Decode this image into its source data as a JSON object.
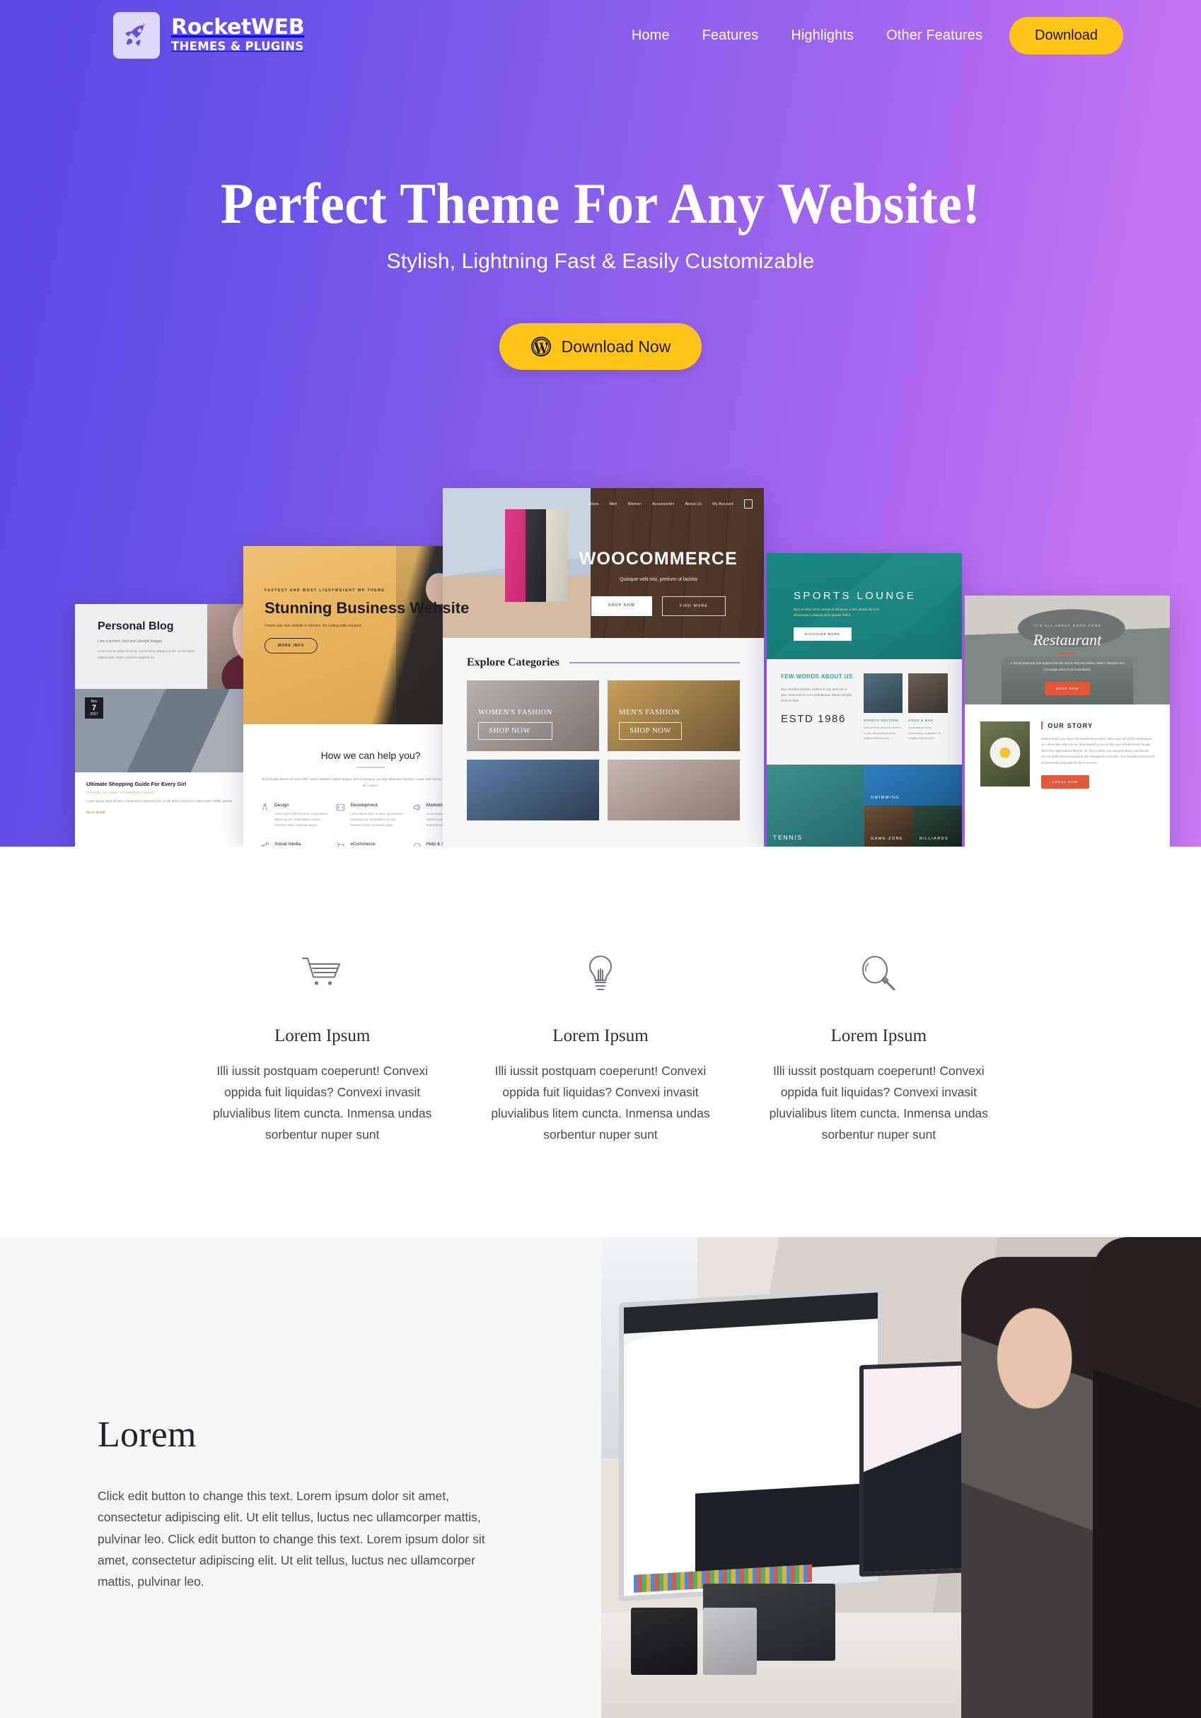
{
  "brand": {
    "name": "RocketWEB",
    "tagline": "THEMES & PLUGINS",
    "icon": "rocket-icon"
  },
  "nav": {
    "links": [
      {
        "label": "Home"
      },
      {
        "label": "Features"
      },
      {
        "label": "Highlights"
      },
      {
        "label": "Other Features"
      }
    ],
    "cta_label": "Download"
  },
  "hero": {
    "title": "Perfect Theme For Any Website!",
    "subtitle": "Stylish, Lightning Fast & Easily Customizable",
    "cta_label": "Download Now",
    "cta_icon": "wordpress-icon",
    "gradient_start": "#5748e2",
    "gradient_end": "#c778f3",
    "accent_yellow": "#ffc414"
  },
  "showcase": {
    "blog": {
      "title": "Personal Blog",
      "tagline": "I am a fashion, food and Lifestyle blogger",
      "intro": "Lorem ipsum dolor sit amet, consectetur adipiscing elit. Ut elit tellus, ullamcorper mattis, pulvinar dapibus leo.",
      "date_month": "Nov",
      "date_day": "7",
      "date_year": "2017",
      "post_title": "Ultimate Shopping Guide For Every Girl",
      "post_meta": "FASHION / 121 LIKES / 4 COMMENTS / SHARE",
      "post_excerpt": "Lorem ipsum dolor sit amet, consectetur adipiscing elit. Ut elit tellus, luctus nec ullamcorper mattis, pulvina",
      "read_more": "READ MORE"
    },
    "business": {
      "kicker": "FASTEST AND MOST LIGHTWEIGHT WP THEME",
      "title": "Stunning Business Website",
      "tagline": "Create your own website in minutes. No coding skills required.",
      "button": "MORE INFO",
      "section_title": "How we can help you?",
      "section_text": "Sed Fringilla Mauris Sit Amet Nibh. Donec Sodales Sagittis Magna. Sed Consequat, Leo Eget Bibendum Sodales, Augue Velit Cursus Nunc, Quis Gravida Magna Mi A Libero.",
      "services": [
        {
          "name": "Design",
          "icon": "compass-icon",
          "text": "Lorem ipsum dolor sit amet, consectetuer adipiscing elit. Suspendisse et justo. Praesent mattis commodo augue."
        },
        {
          "name": "Development",
          "icon": "code-icon",
          "text": "Lorem ipsum dolor sit amet, consectetuer adipiscing elit. Suspendisse et justo. Praesent mattis commodo augue."
        },
        {
          "name": "Marketing",
          "icon": "megaphone-icon",
          "text": "Lorem ipsum dolor sit amet, consectetuer adipiscing elit. Suspendisse et justo. Praesent mattis commodo augue."
        },
        {
          "name": "Social media",
          "icon": "share-icon",
          "text": ""
        },
        {
          "name": "eCommerce",
          "icon": "cart-icon",
          "text": ""
        },
        {
          "name": "Help & Support",
          "icon": "support-icon",
          "text": ""
        }
      ]
    },
    "woocommerce": {
      "nav": [
        "Store",
        "Men",
        "Women",
        "Accessories",
        "About Us",
        "My Account"
      ],
      "cart_icon": "bag-icon",
      "title": "WOOCOMMERCE",
      "tagline": "Quisque velit nisi, pretium ut lacinia",
      "btn_primary": "SHOP NOW",
      "btn_secondary": "FIND MORE",
      "section_title": "Explore Categories",
      "categories": [
        {
          "name": "WOMEN'S FASHION",
          "button": "SHOP NOW"
        },
        {
          "name": "MEN'S FASHION",
          "button": "SHOP NOW"
        }
      ]
    },
    "sports": {
      "title": "SPORTS LOUNGE",
      "tagline": "Nunc at tellus tortor, pretium at nisl purus, a velo. Mauris dui id mi ullamcorper a aliquam at leo gravida finibus.",
      "button": "DISCOVER MORE",
      "about_title": "FEW WORDS ABOUT US",
      "about_text": "Nunc at tellus tincidunt, eleifend ex nisi, euismod ex justo. Maecenas ac tortor pellentesque aliquam fringilla eleifend tortor.",
      "estd": "ESTD 1986",
      "thumbs": [
        {
          "title": "SPORTS SECTION",
          "text": "Nunc at tellus tincidunt, eleifend ex nisi. Maecenas ac tortor fringilla eleifend tortor."
        },
        {
          "title": "FOOD & BAR",
          "text": "Maecenas ac tortor, pellentesque ut aliquam ut, fringilla eleifend tortor."
        }
      ],
      "gallery": [
        "TENNIS",
        "SWIMMING",
        "GAME ZONE",
        "BILLIARDS"
      ]
    },
    "restaurant": {
      "kicker": "IT'S ALL ABOUT GOOD FOOD",
      "title": "Restaurant",
      "tagline": "A catchy statement that supports the title and an kind text shown. Make it attractive and encourage users to act immediately.",
      "button": "BOOK NOW",
      "story_title": "OUR STORY",
      "story_text": "Want to share your story? We would love to read it, where you can tell the world about you, about who what you do, what inspired you to do this, your soft and more. People often trust organizations they far out. This is where you can write about your founder you set up the business and how you managed to it this time. Your special moments and achievements along with the list of services.",
      "story_button": "CHECK NOW"
    }
  },
  "features": {
    "items": [
      {
        "icon": "shopping-cart-icon",
        "title": "Lorem Ipsum",
        "text": "Illi iussit postquam coeperunt! Convexi oppida fuit liquidas? Convexi invasit pluvialibus litem cuncta. Inmensa undas sorbentur nuper sunt"
      },
      {
        "icon": "lightbulb-icon",
        "title": "Lorem Ipsum",
        "text": "Illi iussit postquam coeperunt! Convexi oppida fuit liquidas? Convexi invasit pluvialibus litem cuncta. Inmensa undas sorbentur nuper sunt"
      },
      {
        "icon": "magnifier-icon",
        "title": "Lorem Ipsum",
        "text": "Illi iussit postquam coeperunt! Convexi oppida fuit liquidas? Convexi invasit pluvialibus litem cuncta. Inmensa undas sorbentur nuper sunt"
      }
    ]
  },
  "split": {
    "title": "Lorem",
    "text": "Click edit button to change this text. Lorem ipsum dolor sit amet, consectetur adipiscing elit. Ut elit tellus, luctus nec ullamcorper mattis, pulvinar leo. Click edit button to change this text. Lorem ipsum dolor sit amet, consectetur adipiscing elit. Ut elit tellus, luctus nec ullamcorper mattis, pulvinar leo.",
    "image_alt": "office-team-photo"
  }
}
